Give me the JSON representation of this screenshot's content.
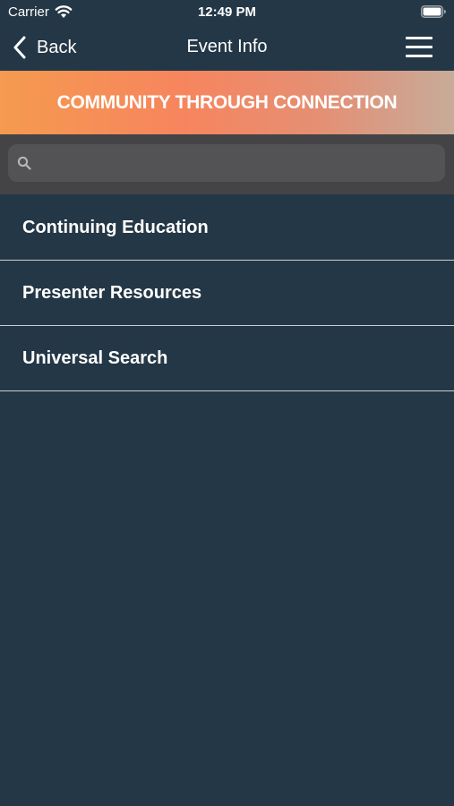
{
  "status_bar": {
    "carrier": "Carrier",
    "time": "12:49 PM"
  },
  "nav": {
    "back_label": "Back",
    "title": "Event Info"
  },
  "banner": {
    "text": "COMMUNITY THROUGH CONNECTION"
  },
  "search": {
    "placeholder": ""
  },
  "list": {
    "items": [
      {
        "label": "Continuing Education"
      },
      {
        "label": "Presenter Resources"
      },
      {
        "label": "Universal Search"
      }
    ]
  },
  "colors": {
    "background": "#243746",
    "banner_start": "#f59a4f",
    "banner_end": "#c7ab99",
    "search_bar": "#444446",
    "divider": "#c9ced2"
  },
  "icons": [
    "wifi-icon",
    "battery-icon",
    "back-chevron-icon",
    "menu-icon",
    "search-icon"
  ]
}
